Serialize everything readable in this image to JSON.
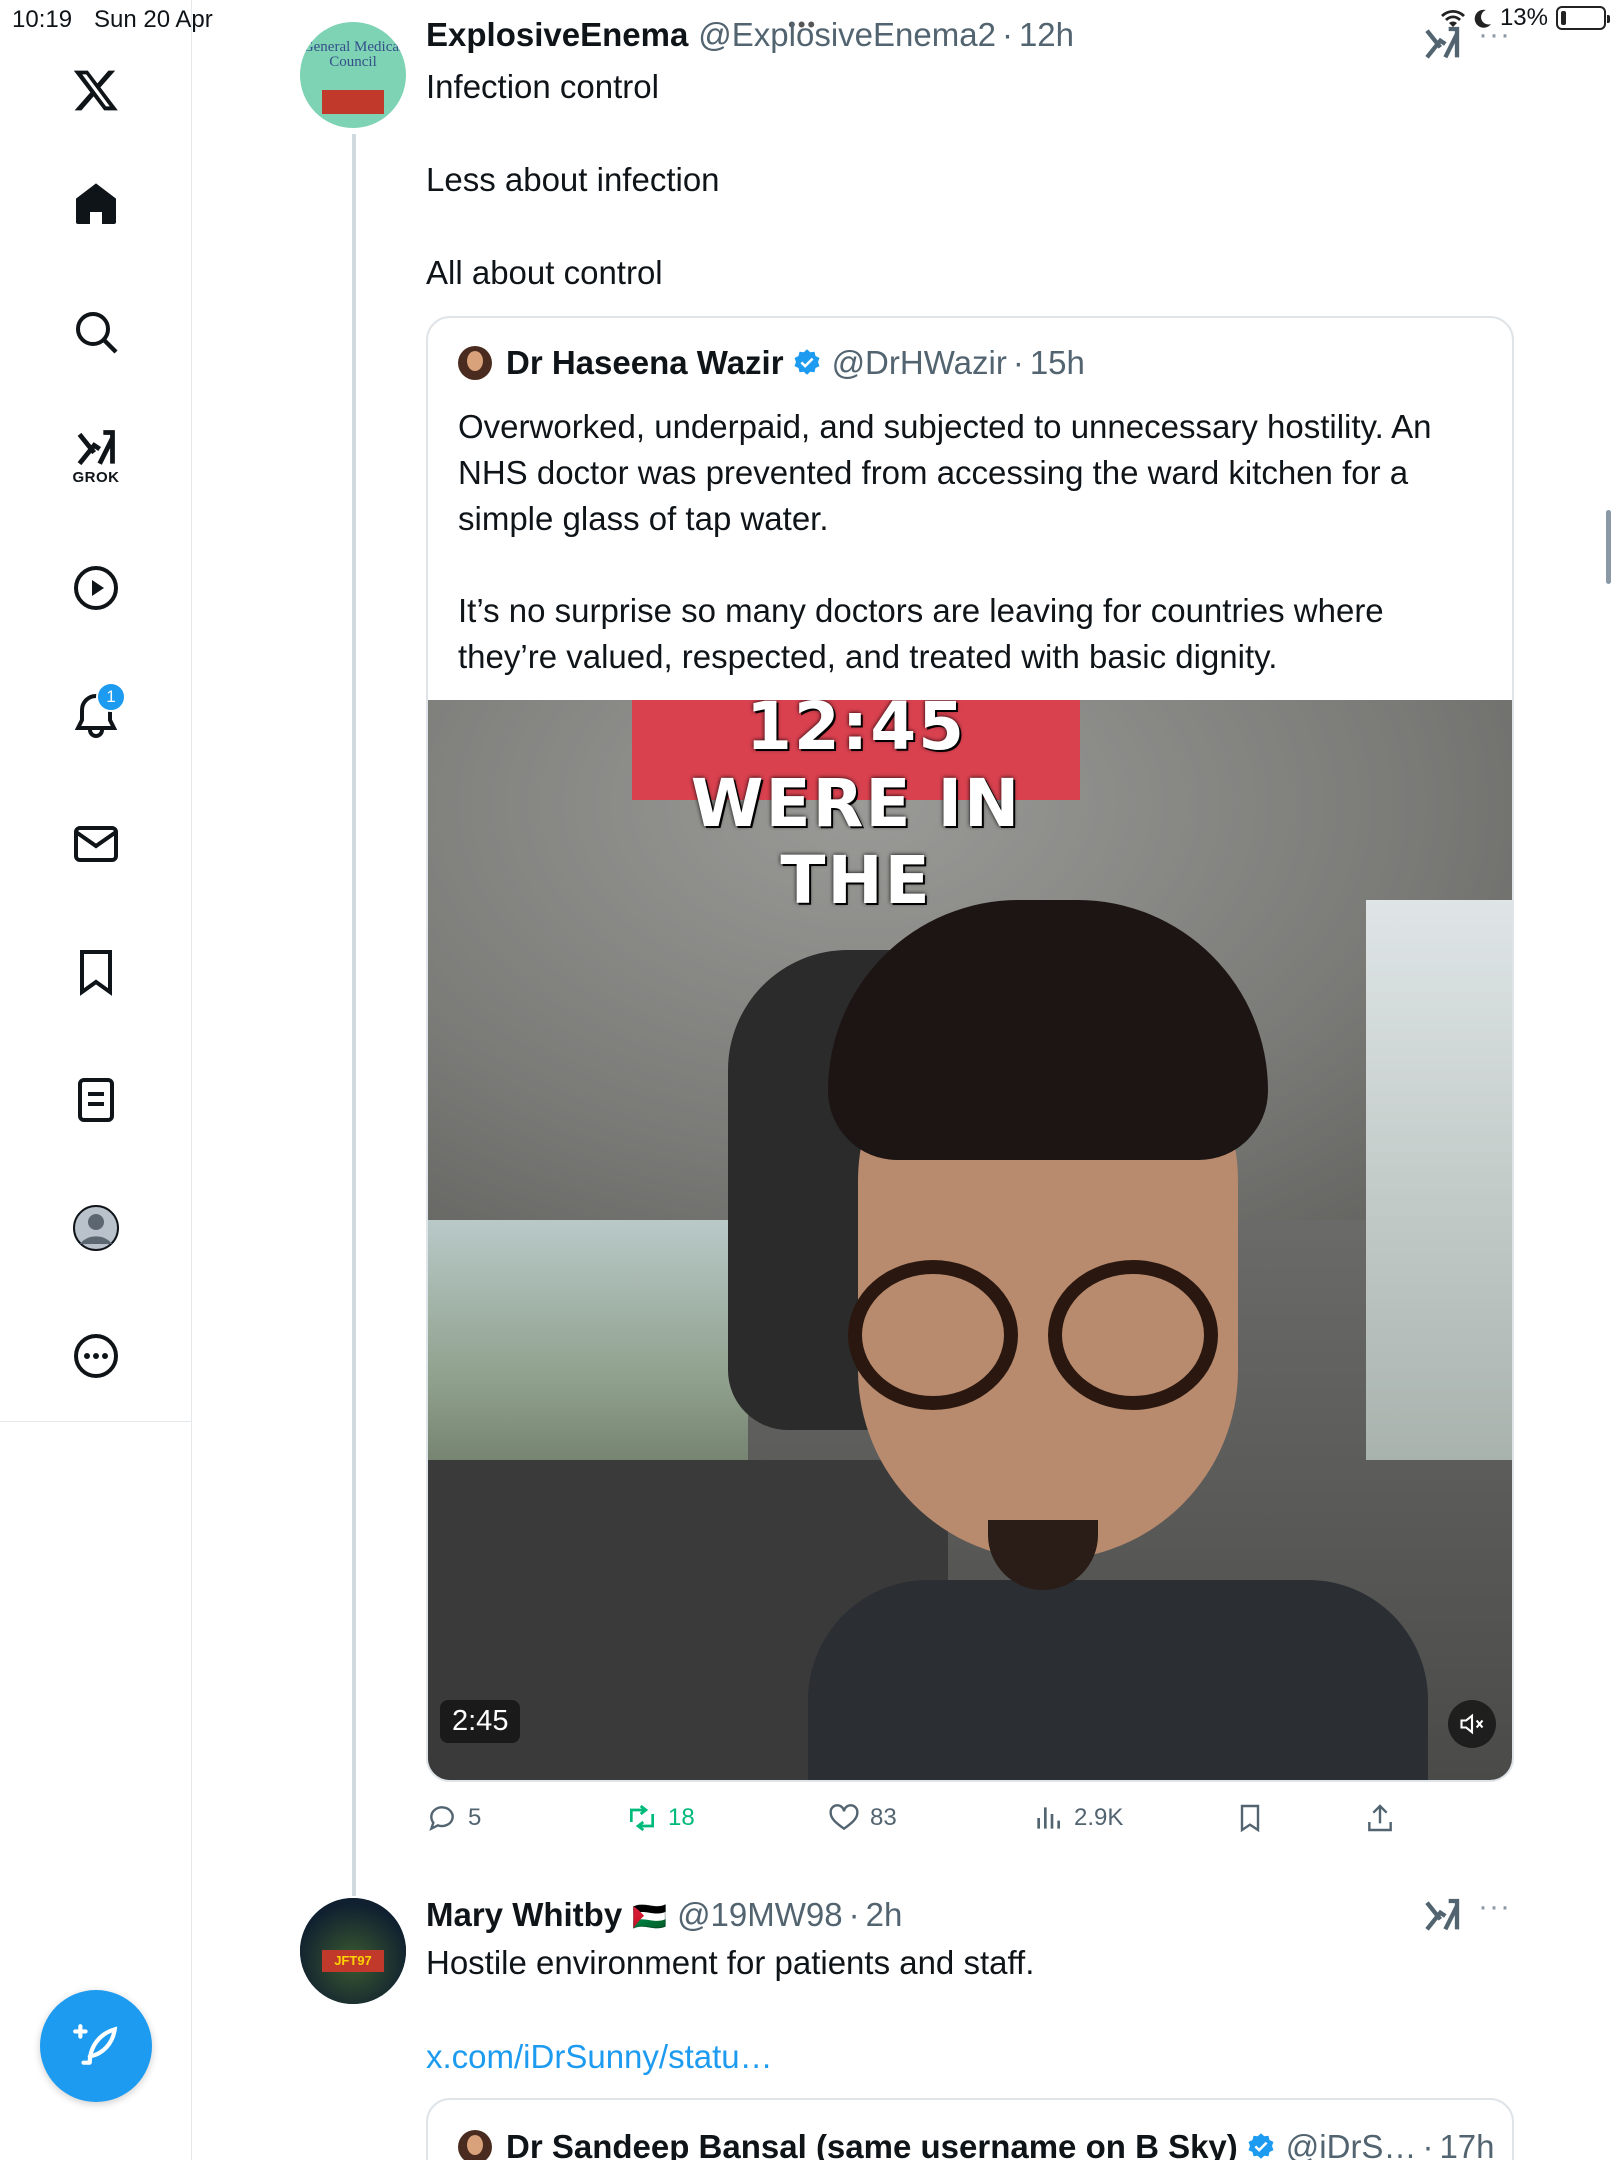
{
  "status_bar": {
    "time": "10:19",
    "date": "Sun 20 Apr",
    "battery": "13%",
    "battery_level": 0.13
  },
  "sidebar": {
    "items": [
      {
        "name": "logo",
        "icon": "x-logo-icon"
      },
      {
        "name": "home",
        "icon": "home-icon"
      },
      {
        "name": "search",
        "icon": "search-icon"
      },
      {
        "name": "grok",
        "icon": "grok-icon",
        "label": "GROK"
      },
      {
        "name": "video",
        "icon": "play-icon"
      },
      {
        "name": "notifications",
        "icon": "bell-icon",
        "badge": "1"
      },
      {
        "name": "messages",
        "icon": "mail-icon"
      },
      {
        "name": "bookmarks",
        "icon": "bookmark-icon"
      },
      {
        "name": "lists",
        "icon": "list-icon"
      },
      {
        "name": "profile",
        "icon": "profile-icon"
      },
      {
        "name": "more",
        "icon": "more-icon"
      }
    ],
    "compose_icon": "compose-icon"
  },
  "tweet1": {
    "avatar_text": "General Medical Council",
    "author_name": "ExplosiveEnema",
    "author_handle": "@ExplosiveEnema2",
    "time": "12h",
    "text_lines": [
      "Infection control",
      "Less about infection",
      "All about control"
    ],
    "quote": {
      "author_name": "Dr Haseena Wazir",
      "author_handle": "@DrHWazir",
      "time": "15h",
      "paragraphs": [
        "Overworked, underpaid, and subjected to unnecessary hostility. An NHS doctor was prevented from accessing the ward kitchen for a simple glass of tap water.",
        "It’s no surprise so many doctors are leaving for countries where they’re valued, respected, and treated with basic dignity."
      ],
      "video_caption": "12:45 WERE IN THE",
      "video_duration": "2:45"
    },
    "actions": {
      "replies": "5",
      "retweets": "18",
      "likes": "83",
      "views": "2.9K"
    }
  },
  "tweet2": {
    "author_name": "Mary Whitby",
    "flag": "🇵🇸",
    "author_handle": "@19MW98",
    "time": "2h",
    "text": "Hostile environment for patients and staff.",
    "link": "x.com/iDrSunny/statu…",
    "avatar_text": "JFT97",
    "quote": {
      "author_name": "Dr Sandeep Bansal (same username on B Sky)",
      "author_handle": "@iDrS…",
      "time": "17h"
    }
  },
  "colors": {
    "accent": "#1d9bf0",
    "retweet_active": "#00ba7c",
    "secondary_text": "#536471"
  }
}
